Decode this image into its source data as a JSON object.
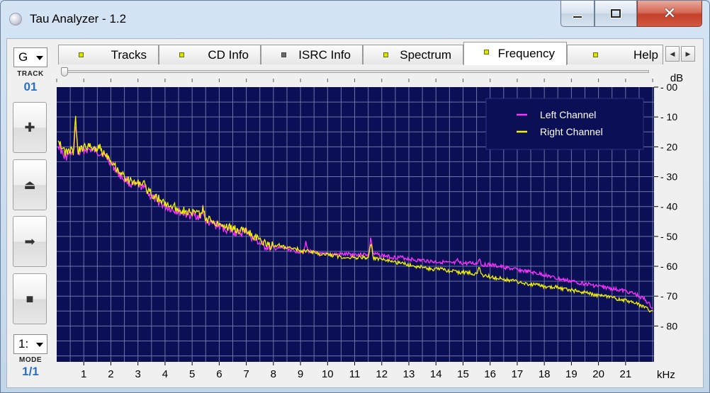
{
  "window": {
    "title": "Tau Analyzer - 1.2"
  },
  "left_panel": {
    "channel_combo": "G",
    "track_label": "TRACK",
    "track_number": "01",
    "buttons": [
      {
        "name": "plus-button",
        "glyph": "✚"
      },
      {
        "name": "eject-button",
        "glyph": "⏏"
      },
      {
        "name": "next-button",
        "glyph": "➡"
      },
      {
        "name": "stop-button",
        "glyph": "■"
      }
    ],
    "mode_combo": "1:",
    "mode_label": "MODE",
    "mode_value": "1/1"
  },
  "tabs": [
    {
      "label": "Tracks",
      "led": "on"
    },
    {
      "label": "CD Info",
      "led": "on"
    },
    {
      "label": "ISRC Info",
      "led": "off"
    },
    {
      "label": "Spectrum",
      "led": "on"
    },
    {
      "label": "Frequency",
      "led": "on",
      "active": true
    },
    {
      "label": "Help",
      "led": "on"
    }
  ],
  "colors": {
    "plot_bg": "#0a0f56",
    "grid": "#6e73a8",
    "left_channel": "#ff33ff",
    "right_channel": "#f4f400"
  },
  "chart_data": {
    "type": "line",
    "xlabel": "kHz",
    "ylabel": "dB",
    "x_ticks": [
      1,
      2,
      3,
      4,
      5,
      6,
      7,
      8,
      9,
      10,
      11,
      12,
      13,
      14,
      15,
      16,
      17,
      18,
      19,
      20,
      21
    ],
    "y_ticks": [
      "- 00",
      "- 10",
      "- 20",
      "- 30",
      "- 40",
      "- 50",
      "- 60",
      "- 70",
      "- 80"
    ],
    "xlim": [
      0,
      22.05
    ],
    "ylim": [
      0,
      92
    ],
    "legend_position": "top-right",
    "series": [
      {
        "name": "Left Channel",
        "points": [
          [
            0.05,
            19
          ],
          [
            0.3,
            24
          ],
          [
            0.5,
            22
          ],
          [
            0.7,
            23
          ],
          [
            1.0,
            21
          ],
          [
            1.3,
            21
          ],
          [
            1.6,
            22
          ],
          [
            1.9,
            24
          ],
          [
            2.2,
            28
          ],
          [
            2.5,
            31
          ],
          [
            2.8,
            33
          ],
          [
            3.1,
            33
          ],
          [
            3.4,
            36
          ],
          [
            3.7,
            38
          ],
          [
            4.0,
            40
          ],
          [
            4.3,
            41
          ],
          [
            4.6,
            42
          ],
          [
            4.9,
            43
          ],
          [
            5.2,
            43
          ],
          [
            5.5,
            45
          ],
          [
            5.8,
            46
          ],
          [
            6.1,
            47
          ],
          [
            6.4,
            48
          ],
          [
            6.7,
            49
          ],
          [
            7.0,
            49
          ],
          [
            7.3,
            51
          ],
          [
            7.6,
            53
          ],
          [
            7.9,
            54
          ],
          [
            8.2,
            54
          ],
          [
            8.5,
            54
          ],
          [
            8.8,
            55
          ],
          [
            9.1,
            55
          ],
          [
            9.4,
            55
          ],
          [
            9.7,
            56
          ],
          [
            10.0,
            56
          ],
          [
            10.3,
            56
          ],
          [
            10.6,
            56
          ],
          [
            10.9,
            56
          ],
          [
            11.2,
            56
          ],
          [
            11.5,
            56
          ],
          [
            11.8,
            56
          ],
          [
            12.1,
            56.5
          ],
          [
            12.4,
            57
          ],
          [
            12.7,
            57
          ],
          [
            13.0,
            57.5
          ],
          [
            13.3,
            58
          ],
          [
            13.6,
            58
          ],
          [
            13.9,
            58.5
          ],
          [
            14.2,
            58.5
          ],
          [
            14.5,
            59
          ],
          [
            14.8,
            59
          ],
          [
            15.1,
            59
          ],
          [
            15.4,
            59
          ],
          [
            15.7,
            59.5
          ],
          [
            16.0,
            59.5
          ],
          [
            16.3,
            60
          ],
          [
            16.6,
            60.5
          ],
          [
            16.9,
            61
          ],
          [
            17.2,
            61.5
          ],
          [
            17.5,
            62
          ],
          [
            17.8,
            62.5
          ],
          [
            18.1,
            63
          ],
          [
            18.4,
            64
          ],
          [
            18.7,
            64.5
          ],
          [
            19.0,
            65
          ],
          [
            19.3,
            65.5
          ],
          [
            19.6,
            66
          ],
          [
            19.9,
            66.5
          ],
          [
            20.2,
            67
          ],
          [
            20.5,
            67.5
          ],
          [
            20.8,
            68
          ],
          [
            21.1,
            68.5
          ],
          [
            21.4,
            69.5
          ],
          [
            21.7,
            71
          ],
          [
            22.0,
            74
          ]
        ],
        "peaks": [
          [
            0.7,
            12
          ],
          [
            1.7,
            22
          ],
          [
            2.6,
            31
          ],
          [
            3.3,
            33
          ],
          [
            5.4,
            40
          ],
          [
            7.0,
            47
          ],
          [
            9.2,
            52
          ],
          [
            11.6,
            50
          ],
          [
            14.8,
            58
          ],
          [
            15.6,
            57
          ]
        ]
      },
      {
        "name": "Right Channel",
        "points": [
          [
            0.05,
            17
          ],
          [
            0.3,
            22
          ],
          [
            0.5,
            21
          ],
          [
            0.7,
            22
          ],
          [
            1.0,
            20
          ],
          [
            1.3,
            20
          ],
          [
            1.6,
            21
          ],
          [
            1.9,
            23
          ],
          [
            2.2,
            27
          ],
          [
            2.5,
            30
          ],
          [
            2.8,
            32
          ],
          [
            3.1,
            32
          ],
          [
            3.4,
            35
          ],
          [
            3.7,
            37
          ],
          [
            4.0,
            39
          ],
          [
            4.3,
            40
          ],
          [
            4.6,
            41
          ],
          [
            4.9,
            42
          ],
          [
            5.2,
            42
          ],
          [
            5.5,
            44
          ],
          [
            5.8,
            45
          ],
          [
            6.1,
            46
          ],
          [
            6.4,
            47
          ],
          [
            6.7,
            48
          ],
          [
            7.0,
            48
          ],
          [
            7.3,
            50
          ],
          [
            7.6,
            52
          ],
          [
            7.9,
            53
          ],
          [
            8.2,
            53
          ],
          [
            8.5,
            54
          ],
          [
            8.8,
            54
          ],
          [
            9.1,
            55
          ],
          [
            9.4,
            55
          ],
          [
            9.7,
            56
          ],
          [
            10.0,
            56
          ],
          [
            10.3,
            56.5
          ],
          [
            10.6,
            57
          ],
          [
            10.9,
            57
          ],
          [
            11.2,
            57
          ],
          [
            11.5,
            57
          ],
          [
            11.8,
            57.5
          ],
          [
            12.1,
            58
          ],
          [
            12.4,
            58.5
          ],
          [
            12.7,
            59
          ],
          [
            13.0,
            59.5
          ],
          [
            13.3,
            60
          ],
          [
            13.6,
            60.5
          ],
          [
            13.9,
            61
          ],
          [
            14.2,
            61
          ],
          [
            14.5,
            61.5
          ],
          [
            14.8,
            62
          ],
          [
            15.1,
            62
          ],
          [
            15.4,
            62.5
          ],
          [
            15.7,
            63
          ],
          [
            16.0,
            63.5
          ],
          [
            16.3,
            64
          ],
          [
            16.6,
            64.5
          ],
          [
            16.9,
            65
          ],
          [
            17.2,
            65.5
          ],
          [
            17.5,
            66
          ],
          [
            17.8,
            66.5
          ],
          [
            18.1,
            67
          ],
          [
            18.4,
            67
          ],
          [
            18.7,
            67.5
          ],
          [
            19.0,
            68
          ],
          [
            19.3,
            68.5
          ],
          [
            19.6,
            69
          ],
          [
            19.9,
            69.5
          ],
          [
            20.2,
            70
          ],
          [
            20.5,
            70.5
          ],
          [
            20.8,
            71
          ],
          [
            21.1,
            71.5
          ],
          [
            21.4,
            72.5
          ],
          [
            21.7,
            73.5
          ],
          [
            22.0,
            75.5
          ]
        ],
        "peaks": [
          [
            0.7,
            10
          ],
          [
            1.6,
            20
          ],
          [
            2.5,
            30
          ],
          [
            3.2,
            32
          ],
          [
            5.4,
            41
          ],
          [
            7.0,
            48
          ],
          [
            11.6,
            52
          ],
          [
            15.6,
            60
          ]
        ]
      }
    ]
  }
}
